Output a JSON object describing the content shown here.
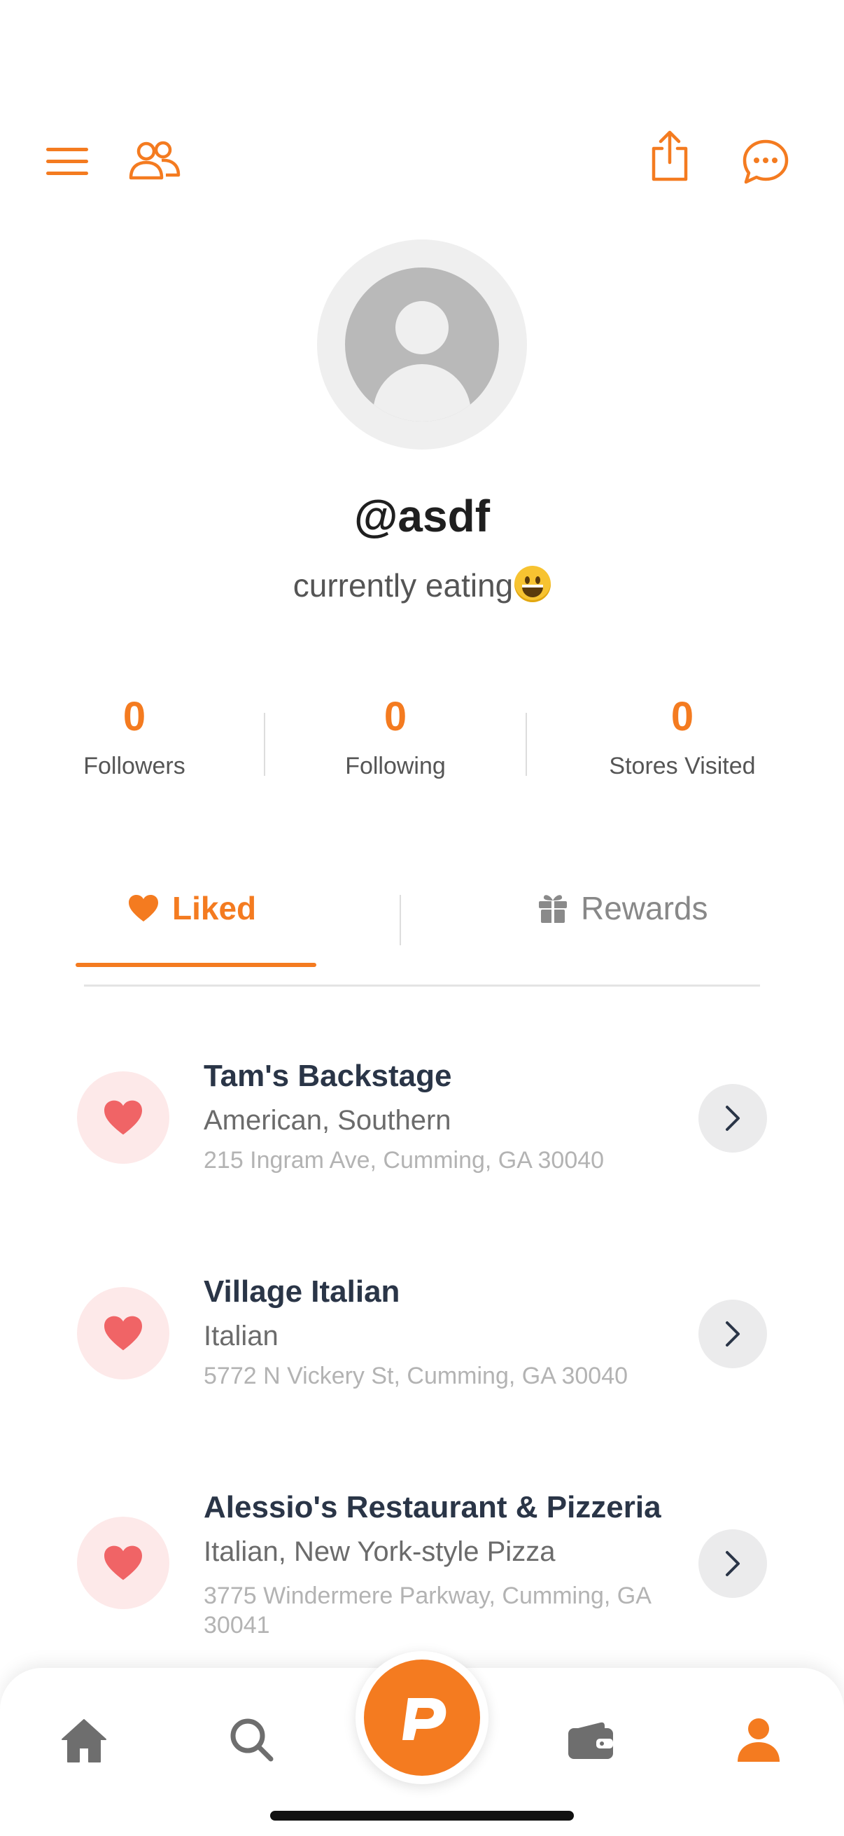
{
  "colors": {
    "accent": "#f47b20",
    "heart": "#f06466",
    "heart_bg": "#fde9e9"
  },
  "topbar": {
    "left_icons": [
      "menu-icon",
      "friends-icon"
    ],
    "right_icons": [
      "share-icon",
      "chat-icon"
    ]
  },
  "profile": {
    "username": "@asdf",
    "bio_text": "currently eating",
    "bio_emoji": "grinning-face-emoji"
  },
  "stats": [
    {
      "value": "0",
      "label": "Followers"
    },
    {
      "value": "0",
      "label": "Following"
    },
    {
      "value": "0",
      "label": "Stores Visited"
    }
  ],
  "tabs": [
    {
      "label": "Liked",
      "icon": "heart-icon",
      "active": true
    },
    {
      "label": "Rewards",
      "icon": "gift-icon",
      "active": false
    }
  ],
  "liked_stores": [
    {
      "name": "Tam's Backstage",
      "cuisine": "American, Southern",
      "address": "215 Ingram Ave, Cumming, GA 30040"
    },
    {
      "name": "Village Italian",
      "cuisine": "Italian",
      "address": "5772 N Vickery St, Cumming, GA 30040"
    },
    {
      "name": "Alessio's Restaurant & Pizzeria",
      "cuisine": "Italian, New York-style Pizza",
      "address": "3775 Windermere Parkway, Cumming, GA 30041"
    }
  ],
  "bottom_nav": {
    "items": [
      "home-icon",
      "search-icon",
      "app-logo-icon",
      "wallet-icon",
      "profile-icon"
    ],
    "active": "profile-icon"
  }
}
